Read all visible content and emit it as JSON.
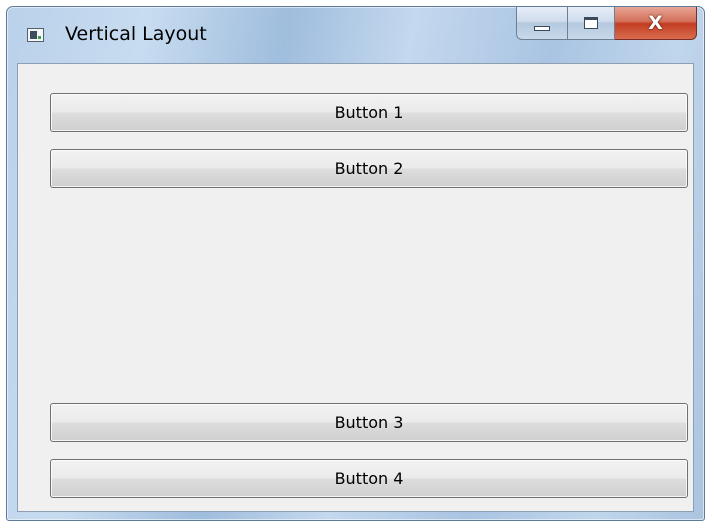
{
  "window": {
    "title": "Vertical Layout",
    "icon": "app-window-icon",
    "caption_buttons": {
      "minimize_icon": "minimize-icon",
      "maximize_icon": "maximize-icon",
      "close_label": "X"
    }
  },
  "layout_buttons": [
    {
      "label": "Button 1"
    },
    {
      "label": "Button 2"
    },
    {
      "label": "Button 3"
    },
    {
      "label": "Button 4"
    }
  ]
}
